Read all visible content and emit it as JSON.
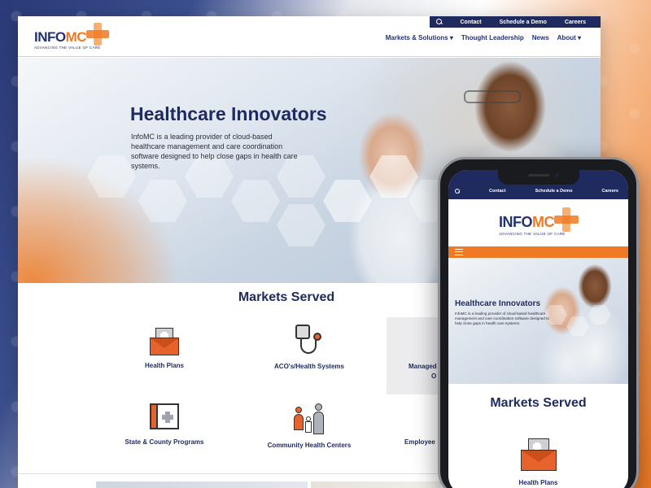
{
  "desktop": {
    "topbar": {
      "links": [
        "Contact",
        "Schedule a Demo",
        "Careers"
      ]
    },
    "logo": {
      "brand_info": "INFO",
      "brand_mc": "MC",
      "tagline": "ADVANCING THE VALUE OF CARE"
    },
    "nav": [
      "Markets & Solutions ▾",
      "Thought Leadership",
      "News",
      "About ▾"
    ],
    "hero": {
      "title": "Healthcare Innovators",
      "text": "InfoMC is a leading provider of cloud-based healthcare management and care coordination software designed to help close gaps in health care systems."
    },
    "markets": {
      "title": "Markets Served",
      "items": [
        {
          "label": "Health Plans",
          "icon": "envelope-medical-icon"
        },
        {
          "label": "ACO's/Health Systems",
          "icon": "stethoscope-icon"
        },
        {
          "label": "Managed",
          "label2": "O",
          "icon": ""
        },
        {
          "label": "State & County Programs",
          "icon": "medical-folder-icon"
        },
        {
          "label": "Community Health Centers",
          "icon": "family-icon"
        },
        {
          "label": "Employee",
          "icon": ""
        }
      ]
    }
  },
  "mobile": {
    "topbar": {
      "links": [
        "Contact",
        "Schedule a Demo",
        "Careers"
      ]
    },
    "logo": {
      "brand_info": "INFO",
      "brand_mc": "MC",
      "tagline": "ADVANCING THE VALUE OF CARE"
    },
    "hero": {
      "title": "Healthcare Innovators",
      "text": "InfoMC is a leading provider of cloud-based healthcare management and care coordination software designed to help close gaps in health care systems."
    },
    "markets": {
      "title": "Markets Served",
      "first_item": "Health Plans"
    }
  },
  "colors": {
    "navy": "#1f2a5e",
    "orange": "#f07a23",
    "icon_orange": "#e8632b"
  }
}
